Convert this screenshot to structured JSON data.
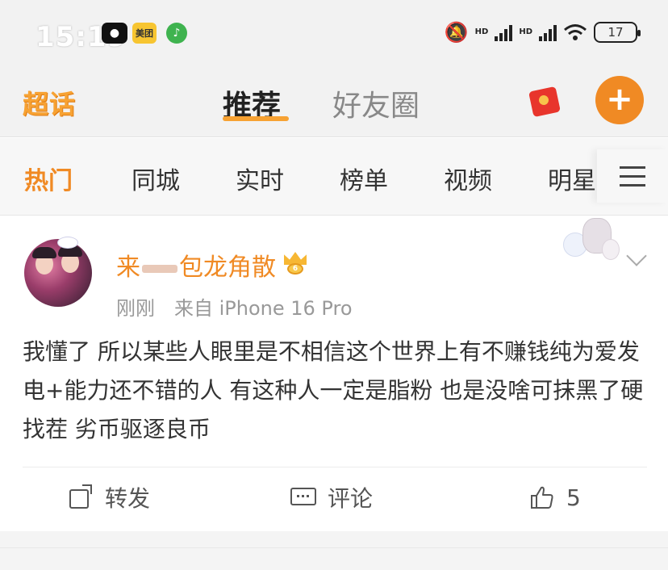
{
  "status_bar": {
    "time": "15:19",
    "app_icons": [
      "messenger-icon",
      "meituan-icon",
      "qq-music-icon"
    ],
    "meituan_label": "美团",
    "hd_label": "HD",
    "battery": "17"
  },
  "header": {
    "logo": "超话",
    "tabs": [
      {
        "label": "推荐",
        "active": true
      },
      {
        "label": "好友圈",
        "active": false
      }
    ],
    "plus_label": "+"
  },
  "categories": {
    "items": [
      {
        "label": "热门",
        "active": true
      },
      {
        "label": "同城"
      },
      {
        "label": "实时"
      },
      {
        "label": "榜单"
      },
      {
        "label": "视频"
      },
      {
        "label": "明星"
      }
    ]
  },
  "post": {
    "username_prefix": "来",
    "username_suffix": "包龙角散",
    "badge_level": "6",
    "time": "刚刚",
    "source": "来自 iPhone 16 Pro",
    "content": "我懂了 所以某些人眼里是不相信这个世界上有不赚钱纯为爱发电+能力还不错的人 有这种人一定是脂粉 也是没啥可抹黑了硬找茬 劣币驱逐良币",
    "actions": {
      "repost": "转发",
      "comment": "评论",
      "like_count": "5"
    }
  },
  "colors": {
    "accent": "#f08a24",
    "logo": "#f7a233",
    "text": "#333333",
    "muted": "#999999"
  }
}
